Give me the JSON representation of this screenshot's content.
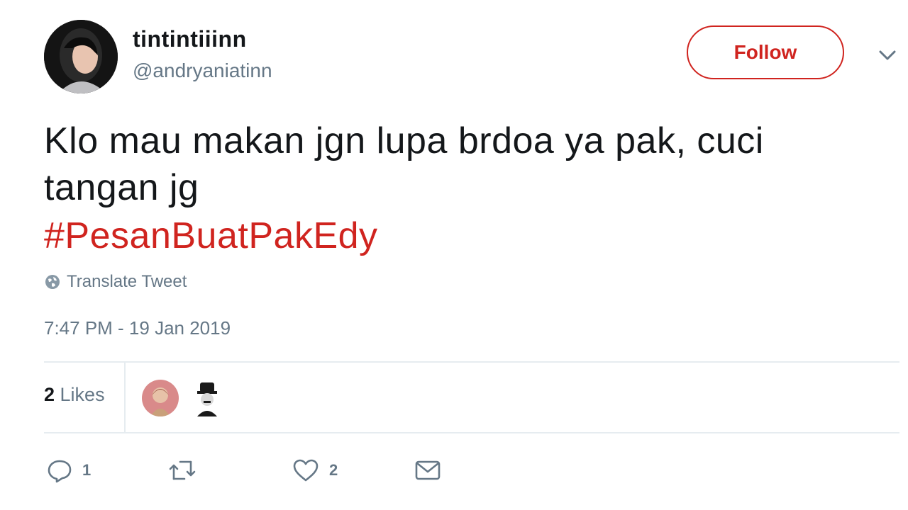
{
  "user": {
    "display_name": "tintintiiinn",
    "handle": "@andryaniatinn"
  },
  "follow_label": "Follow",
  "tweet": {
    "text": "Klo mau makan jgn lupa brdoa ya pak, cuci tangan jg",
    "hashtag": "#PesanBuatPakEdy",
    "translate_label": "Translate Tweet",
    "timestamp": "7:47 PM - 19 Jan 2019"
  },
  "likes": {
    "count": "2",
    "label": " Likes"
  },
  "actions": {
    "reply_count": "1",
    "like_count": "2"
  },
  "icons": [
    "reply-icon",
    "retweet-icon",
    "heart-icon",
    "envelope-icon",
    "globe-icon",
    "chevron-down-icon"
  ],
  "colors": {
    "accent": "#d0241f",
    "secondary_text": "#657786",
    "divider": "#e6ecf0"
  }
}
